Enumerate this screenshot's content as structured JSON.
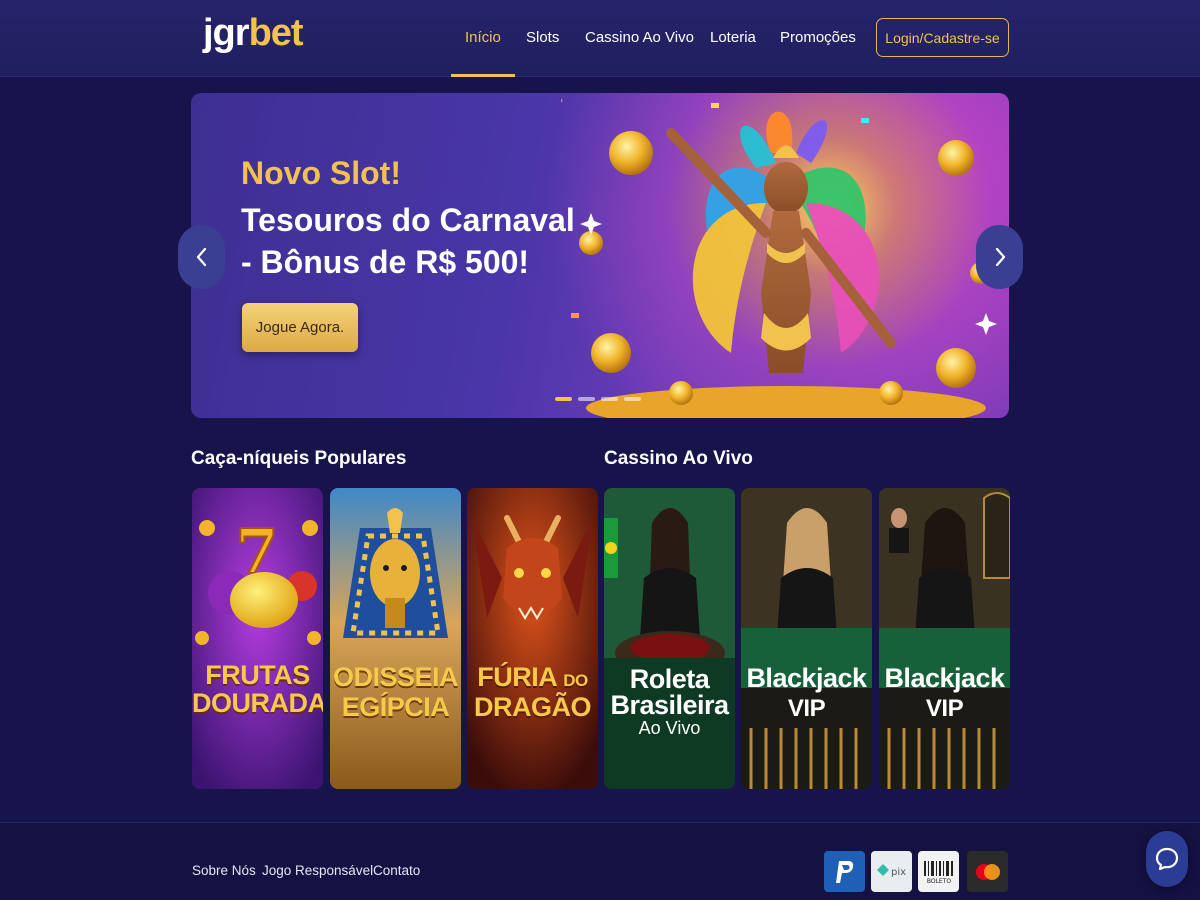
{
  "header": {
    "logo_main": "jgr",
    "logo_accent": "bet",
    "nav": [
      {
        "label": "Início",
        "active": true
      },
      {
        "label": "Slots",
        "active": false
      },
      {
        "label": "Cassino Ao Vivo",
        "active": false
      },
      {
        "label": "Loteria",
        "active": false
      },
      {
        "label": "Promoções",
        "active": false
      }
    ],
    "login_label": "Login/Cadastre-se"
  },
  "banner": {
    "kicker": "Novo Slot!",
    "title": "Tesouros do Carnaval - Bônus de R$ 500!",
    "cta": "Jogue Agora.",
    "slide_count": 4,
    "active_slide": 1,
    "prev_icon": "chevron-left-icon",
    "next_icon": "chevron-right-icon"
  },
  "sections": {
    "slots_title": "Caça-níqueis Populares",
    "live_title": "Cassino Ao Vivo"
  },
  "slots": [
    {
      "title_line1": "FRUTAS",
      "title_line2": "DOURADAS"
    },
    {
      "title_line1": "ODISSEIA",
      "title_line2": "EGÍPCIA"
    },
    {
      "title_line1": "FÚRIA",
      "title_small": "DO",
      "title_line2": "DRAGÃO"
    }
  ],
  "live": [
    {
      "title_line1": "Roleta",
      "title_line2": "Brasileira",
      "subtitle": "Ao Vivo"
    },
    {
      "title_line1": "Blackjack",
      "subtitle": "VIP"
    },
    {
      "title_line1": "Blackjack",
      "subtitle": "VIP"
    }
  ],
  "footer": {
    "links": [
      "Sobre Nós",
      "Jogo Responsável",
      "Contato"
    ],
    "payments": [
      {
        "name": "PayPal",
        "icon": "paypal-icon"
      },
      {
        "name": "pix",
        "icon": "pix-icon"
      },
      {
        "name": "BOLETO",
        "icon": "boleto-icon"
      },
      {
        "name": "mastercard",
        "icon": "mastercard-icon"
      }
    ]
  },
  "colors": {
    "background": "#16144a",
    "header": "#25246a",
    "accent_gold": "#f2c24f",
    "chat_button": "#2b3c95"
  }
}
